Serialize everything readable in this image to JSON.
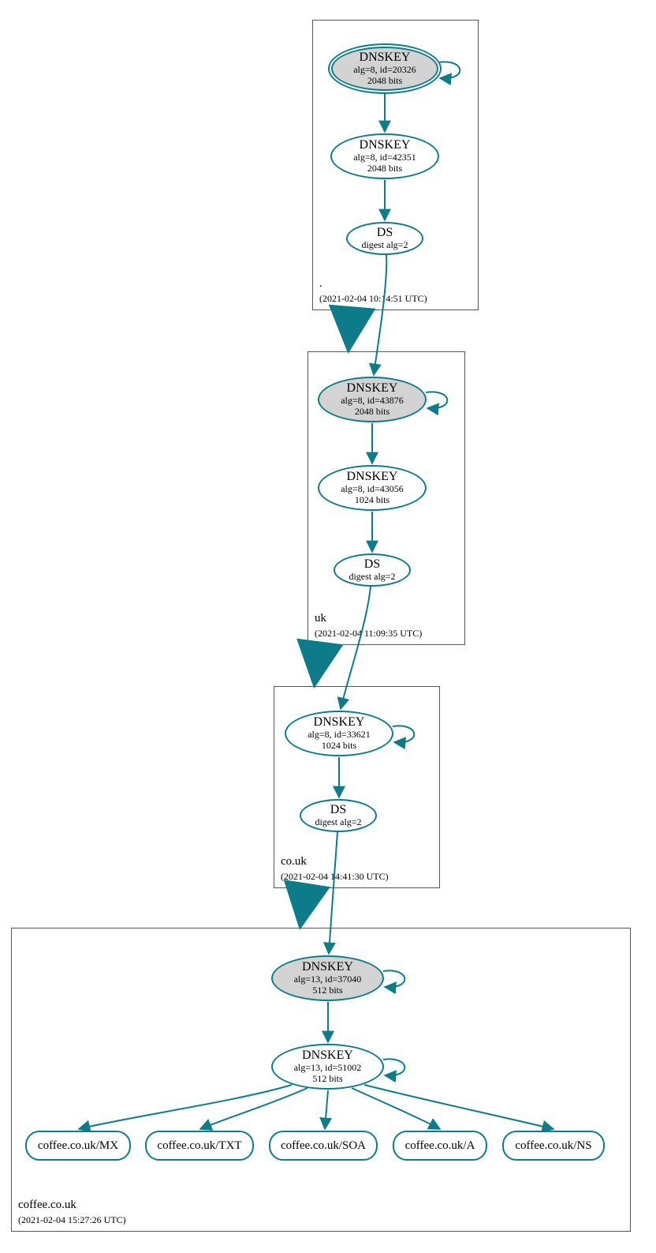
{
  "zones": {
    "root": {
      "name": ".",
      "time": "(2021-02-04 10:14:51 UTC)"
    },
    "uk": {
      "name": "uk",
      "time": "(2021-02-04 11:09:35 UTC)"
    },
    "couk": {
      "name": "co.uk",
      "time": "(2021-02-04 14:41:30 UTC)"
    },
    "coffee": {
      "name": "coffee.co.uk",
      "time": "(2021-02-04 15:27:26 UTC)"
    }
  },
  "nodes": {
    "root_ksk": {
      "title": "DNSKEY",
      "line2": "alg=8, id=20326",
      "line3": "2048 bits"
    },
    "root_zsk": {
      "title": "DNSKEY",
      "line2": "alg=8, id=42351",
      "line3": "2048 bits"
    },
    "root_ds": {
      "title": "DS",
      "line2": "digest alg=2"
    },
    "uk_ksk": {
      "title": "DNSKEY",
      "line2": "alg=8, id=43876",
      "line3": "2048 bits"
    },
    "uk_zsk": {
      "title": "DNSKEY",
      "line2": "alg=8, id=43056",
      "line3": "1024 bits"
    },
    "uk_ds": {
      "title": "DS",
      "line2": "digest alg=2"
    },
    "couk_ksk": {
      "title": "DNSKEY",
      "line2": "alg=8, id=33621",
      "line3": "1024 bits"
    },
    "couk_ds": {
      "title": "DS",
      "line2": "digest alg=2"
    },
    "coffee_ksk": {
      "title": "DNSKEY",
      "line2": "alg=13, id=37040",
      "line3": "512 bits"
    },
    "coffee_zsk": {
      "title": "DNSKEY",
      "line2": "alg=13, id=51002",
      "line3": "512 bits"
    }
  },
  "records": {
    "mx": "coffee.co.uk/MX",
    "txt": "coffee.co.uk/TXT",
    "soa": "coffee.co.uk/SOA",
    "a": "coffee.co.uk/A",
    "ns": "coffee.co.uk/NS"
  }
}
